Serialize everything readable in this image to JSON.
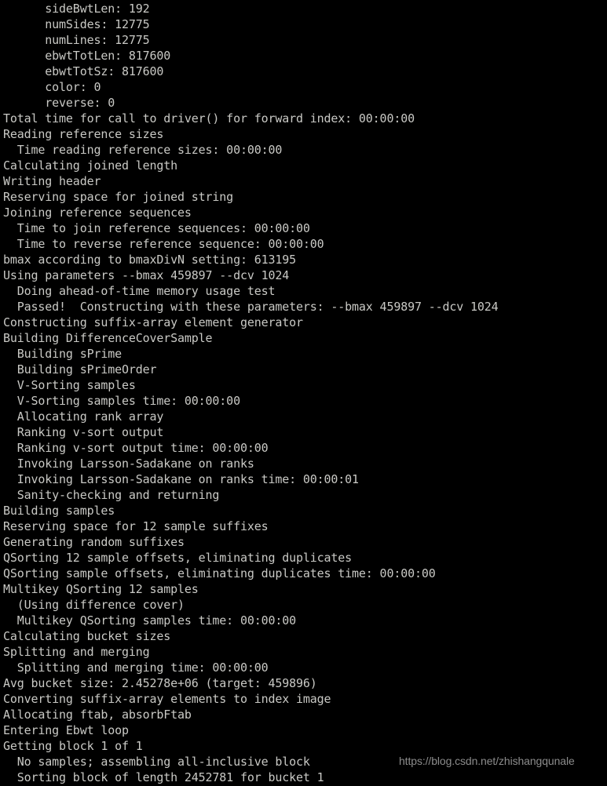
{
  "terminal": {
    "background_color": "#000000",
    "text_color": "#c9c9c5",
    "lines": [
      "      sideBwtLen: 192",
      "      numSides: 12775",
      "      numLines: 12775",
      "      ebwtTotLen: 817600",
      "      ebwtTotSz: 817600",
      "      color: 0",
      "      reverse: 0",
      "Total time for call to driver() for forward index: 00:00:00",
      "Reading reference sizes",
      "  Time reading reference sizes: 00:00:00",
      "Calculating joined length",
      "Writing header",
      "Reserving space for joined string",
      "Joining reference sequences",
      "  Time to join reference sequences: 00:00:00",
      "  Time to reverse reference sequence: 00:00:00",
      "bmax according to bmaxDivN setting: 613195",
      "Using parameters --bmax 459897 --dcv 1024",
      "  Doing ahead-of-time memory usage test",
      "  Passed!  Constructing with these parameters: --bmax 459897 --dcv 1024",
      "Constructing suffix-array element generator",
      "Building DifferenceCoverSample",
      "  Building sPrime",
      "  Building sPrimeOrder",
      "  V-Sorting samples",
      "  V-Sorting samples time: 00:00:00",
      "  Allocating rank array",
      "  Ranking v-sort output",
      "  Ranking v-sort output time: 00:00:00",
      "  Invoking Larsson-Sadakane on ranks",
      "  Invoking Larsson-Sadakane on ranks time: 00:00:01",
      "  Sanity-checking and returning",
      "Building samples",
      "Reserving space for 12 sample suffixes",
      "Generating random suffixes",
      "QSorting 12 sample offsets, eliminating duplicates",
      "QSorting sample offsets, eliminating duplicates time: 00:00:00",
      "Multikey QSorting 12 samples",
      "  (Using difference cover)",
      "  Multikey QSorting samples time: 00:00:00",
      "Calculating bucket sizes",
      "Splitting and merging",
      "  Splitting and merging time: 00:00:00",
      "Avg bucket size: 2.45278e+06 (target: 459896)",
      "Converting suffix-array elements to index image",
      "Allocating ftab, absorbFtab",
      "Entering Ebwt loop",
      "Getting block 1 of 1",
      "  No samples; assembling all-inclusive block",
      "  Sorting block of length 2452781 for bucket 1"
    ]
  },
  "watermark": {
    "text": "https://blog.csdn.net/zhishangqunale",
    "color": "#8c8c8c"
  }
}
